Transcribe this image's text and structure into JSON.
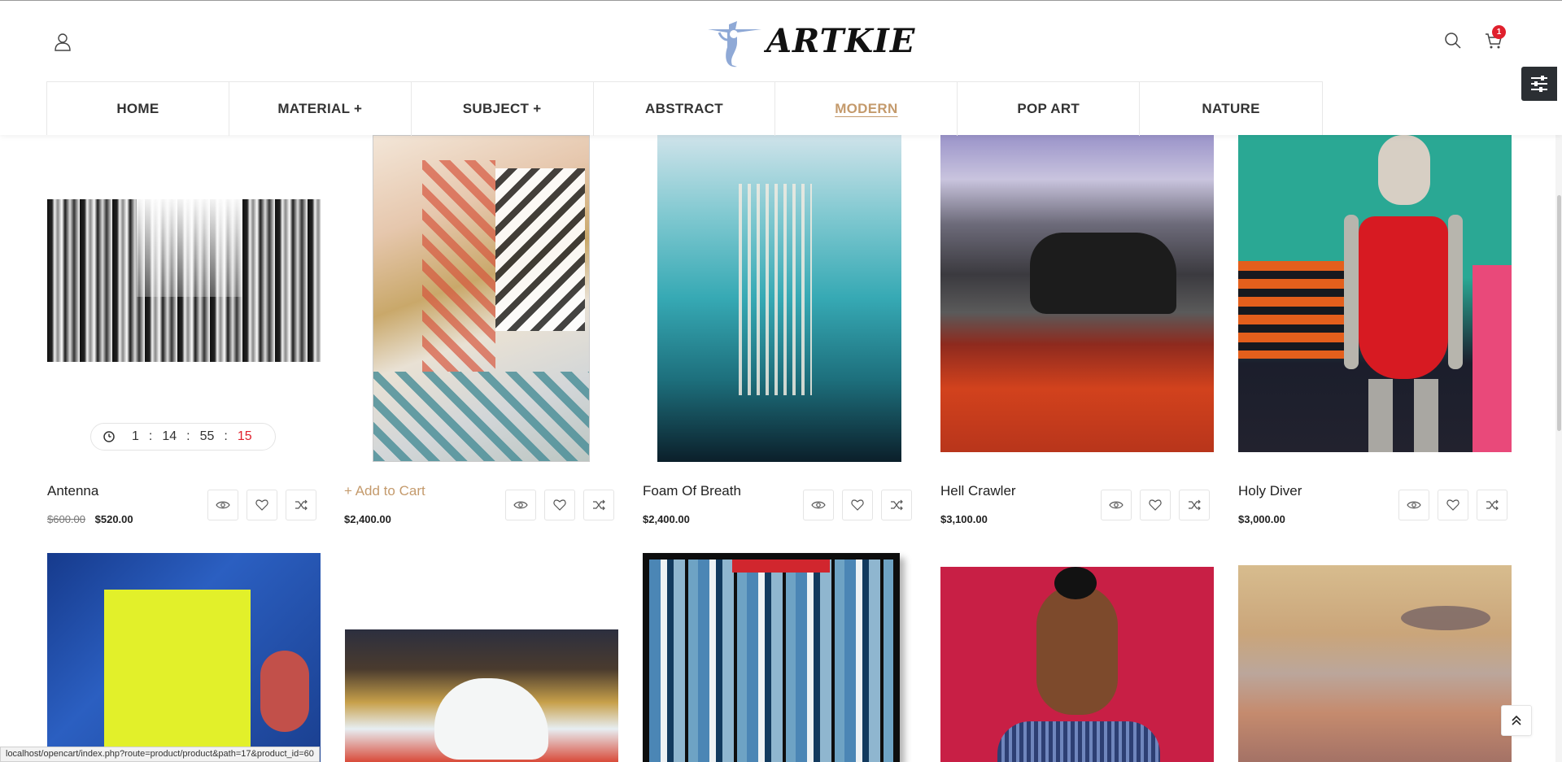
{
  "header": {
    "logo_text": "ARTKIE",
    "cart_count": "1",
    "nav": [
      "HOME",
      "MATERIAL +",
      "SUBJECT +",
      "ABSTRACT",
      "MODERN",
      "POP ART",
      "NATURE"
    ],
    "active_nav": "MODERN"
  },
  "products_row1": [
    {
      "name": "Antenna",
      "price": "$520.00",
      "old_price": "$600.00"
    },
    {
      "name": "+ Add to Cart",
      "price": "$2,400.00"
    },
    {
      "name": "Foam Of Breath",
      "price": "$2,400.00"
    },
    {
      "name": "Hell Crawler",
      "price": "$3,100.00"
    },
    {
      "name": "Holy Diver",
      "price": "$3,000.00"
    }
  ],
  "countdown": {
    "days": "1",
    "hours": "14",
    "minutes": "55",
    "seconds": "15"
  },
  "status_url": "localhost/opencart/index.php?route=product/product&path=17&product_id=60",
  "colors": {
    "accent": "#c49a6c",
    "badge": "#e0202d"
  }
}
